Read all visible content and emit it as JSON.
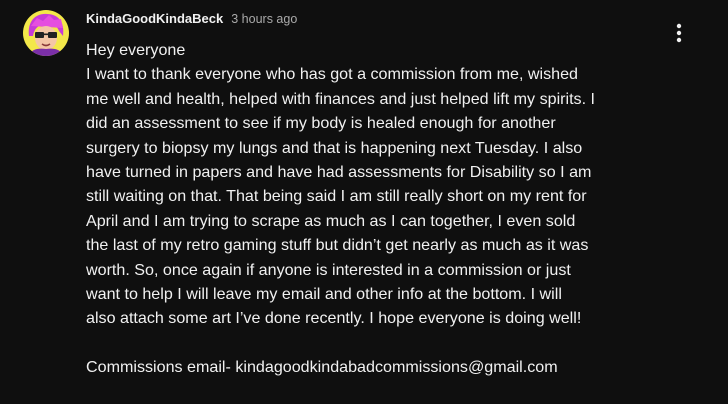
{
  "post": {
    "author": "KindaGoodKindaBeck",
    "timestamp": "3 hours ago",
    "lines": [
      "Hey everyone",
      "I want to thank everyone who has got a commission from me, wished",
      "me well and health, helped with finances and just helped lift my spirits. I",
      "did an assessment to see if my body is healed enough for another",
      "surgery to biopsy my lungs and that is happening next Tuesday. I also",
      "have turned in papers and have had assessments for Disability so I am",
      "still waiting on that. That being said I am still really short on my rent for",
      "April and I am trying to scrape as much as I can together, I even sold",
      "the last of my retro gaming stuff but didn’t get nearly as much as it was",
      "worth. So, once again if anyone is interested in a commission or just",
      "want to help I will leave my email and other info at the bottom. I will",
      "also attach some art I’ve done recently. I hope everyone is doing well!",
      "",
      "Commissions email- kindagoodkindabadcommissions@gmail.com"
    ]
  },
  "icons": {
    "avatar": "avatar-icon",
    "menu": "more-vertical-icon"
  },
  "colors": {
    "background": "#0f0f0f",
    "text": "#f1f1f1",
    "secondary_text": "#aaaaaa",
    "avatar_background": "#f3e84a",
    "avatar_accent": "#c63bd8"
  }
}
